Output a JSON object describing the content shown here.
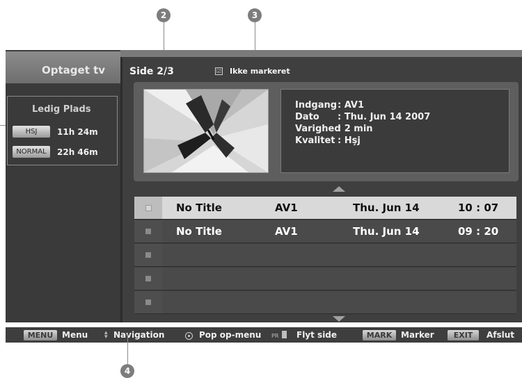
{
  "callouts": {
    "c2": "2",
    "c3": "3",
    "c4": "4"
  },
  "sidebar": {
    "title": "Optaget tv",
    "space_title": "Ledig Plads",
    "modes": [
      {
        "badge": "HSJ",
        "time": "11h 24m"
      },
      {
        "badge": "NORMAL",
        "time": "22h 46m"
      }
    ]
  },
  "header": {
    "page": "Side 2/3",
    "filter_check": "☑",
    "filter_label": "Ikke markeret"
  },
  "details": {
    "rows": [
      {
        "key": "Indgang",
        "value": ": AV1"
      },
      {
        "key": "Dato",
        "value": ": Thu. Jun 14 2007"
      },
      {
        "key": "Varighed",
        "value": ": 2 min"
      },
      {
        "key": "Kvalitet",
        "value": ": Hşj"
      }
    ]
  },
  "recordings": [
    {
      "title": "No Title",
      "input": "AV1",
      "date": "Thu. Jun 14",
      "time": "10 : 07",
      "selected": true
    },
    {
      "title": "No Title",
      "input": "AV1",
      "date": "Thu. Jun 14",
      "time": "09 : 20",
      "selected": false
    }
  ],
  "bottom": {
    "menu_key": "MENU",
    "menu_label": "Menu",
    "nav_label": "Navigation",
    "popup_label": "Pop op-menu",
    "pr_text": "PR",
    "page_label": "Flyt side",
    "mark_key": "MARK",
    "mark_label": "Marker",
    "exit_key": "EXIT",
    "exit_label": "Afslut"
  },
  "colors": {
    "selected_row": "#d9d9d9",
    "row": "#4a4a4a",
    "panel": "#3a3a3a"
  }
}
